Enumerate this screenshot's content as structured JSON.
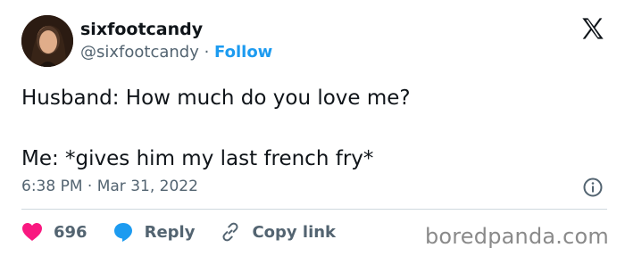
{
  "author": {
    "display_name": "sixfootcandy",
    "handle": "@sixfootcandy",
    "separator": " · ",
    "follow_label": "Follow"
  },
  "tweet": {
    "text": "Husband: How much do you love me?\n\nMe: *gives him my last french fry*",
    "timestamp": "6:38 PM · Mar 31, 2022"
  },
  "actions": {
    "like_count": "696",
    "reply_label": "Reply",
    "copy_link_label": "Copy link"
  },
  "watermark": "boredpanda.com",
  "icons": {
    "brand": "x-logo-icon",
    "like": "heart-icon",
    "reply": "speech-bubble-icon",
    "copy": "link-icon",
    "info": "info-icon"
  },
  "colors": {
    "accent": "#1d9bf0",
    "heart": "#f91880",
    "secondary_text": "#536471"
  }
}
